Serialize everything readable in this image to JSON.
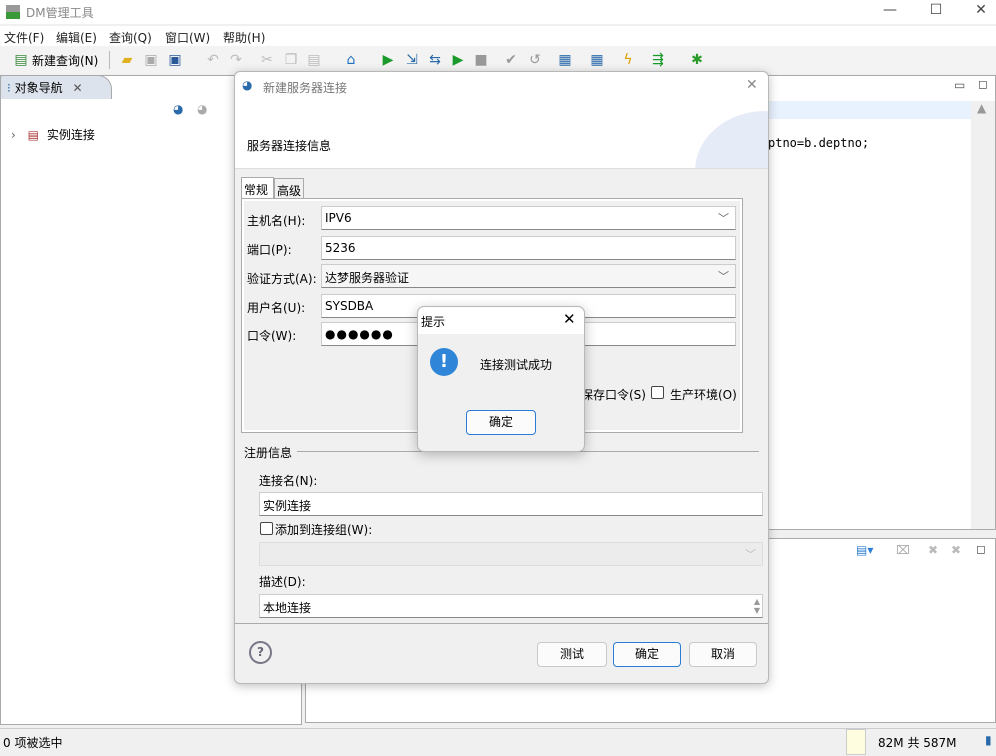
{
  "app": {
    "title": "DM管理工具"
  },
  "menu": [
    "文件(F)",
    "编辑(E)",
    "查询(Q)",
    "窗口(W)",
    "帮助(H)"
  ],
  "toolbar": {
    "new_query": "新建查询(N)"
  },
  "nav": {
    "tab": "对象导航",
    "tree": [
      {
        "label": "实例连接"
      }
    ]
  },
  "editor": {
    "code_fragment": "ptno=b.deptno;"
  },
  "status": {
    "selection": "0 项被选中",
    "memory": "82M 共 587M"
  },
  "dialog": {
    "title": "新建服务器连接",
    "header": "服务器连接信息",
    "tabs": [
      "常规",
      "高级"
    ],
    "fields": {
      "host": {
        "label": "主机名(H):",
        "value": "IPV6"
      },
      "port": {
        "label": "端口(P):",
        "value": "5236"
      },
      "auth": {
        "label": "验证方式(A):",
        "value": "达梦服务器验证"
      },
      "user": {
        "label": "用户名(U):",
        "value": "SYSDBA"
      },
      "password": {
        "label": "口令(W):",
        "value": "●●●●●●"
      }
    },
    "save_password": "保存口令(S)",
    "production": "生产环境(O)",
    "reg_section": "注册信息",
    "conn_name_label": "连接名(N):",
    "conn_name": "实例连接",
    "add_group_label": "添加到连接组(W):",
    "desc_label": "描述(D):",
    "desc": "本地连接",
    "buttons": {
      "test": "测试",
      "ok": "确定",
      "cancel": "取消"
    }
  },
  "alert": {
    "title": "提示",
    "message": "连接测试成功",
    "ok": "确定"
  },
  "colors": {
    "accent": "#2b7cd3",
    "info_icon": "#2f86d8"
  }
}
